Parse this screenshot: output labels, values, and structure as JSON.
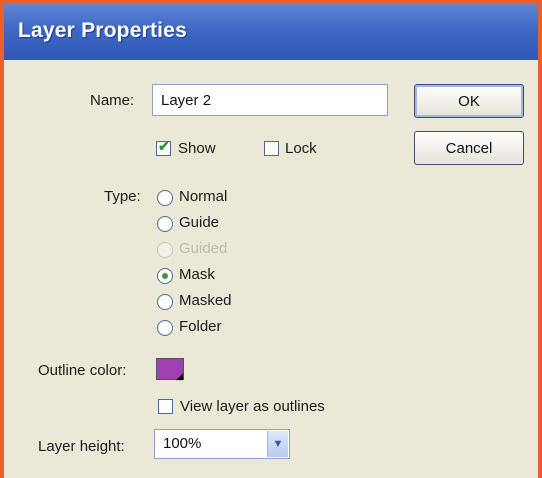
{
  "dialog": {
    "title": "Layer Properties"
  },
  "name": {
    "label": "Name:",
    "value": "Layer 2"
  },
  "buttons": {
    "ok": "OK",
    "cancel": "Cancel"
  },
  "show": {
    "label": "Show",
    "checked": true
  },
  "lock": {
    "label": "Lock",
    "checked": false
  },
  "type": {
    "label": "Type:",
    "options": [
      {
        "label": "Normal",
        "selected": false,
        "disabled": false
      },
      {
        "label": "Guide",
        "selected": false,
        "disabled": false
      },
      {
        "label": "Guided",
        "selected": false,
        "disabled": true
      },
      {
        "label": "Mask",
        "selected": true,
        "disabled": false
      },
      {
        "label": "Masked",
        "selected": false,
        "disabled": false
      },
      {
        "label": "Folder",
        "selected": false,
        "disabled": false
      }
    ]
  },
  "outline": {
    "label": "Outline color:",
    "color": "#9f3fb0"
  },
  "view_outlines": {
    "label": "View layer as outlines",
    "checked": false
  },
  "layer_height": {
    "label": "Layer height:",
    "value": "100%"
  }
}
